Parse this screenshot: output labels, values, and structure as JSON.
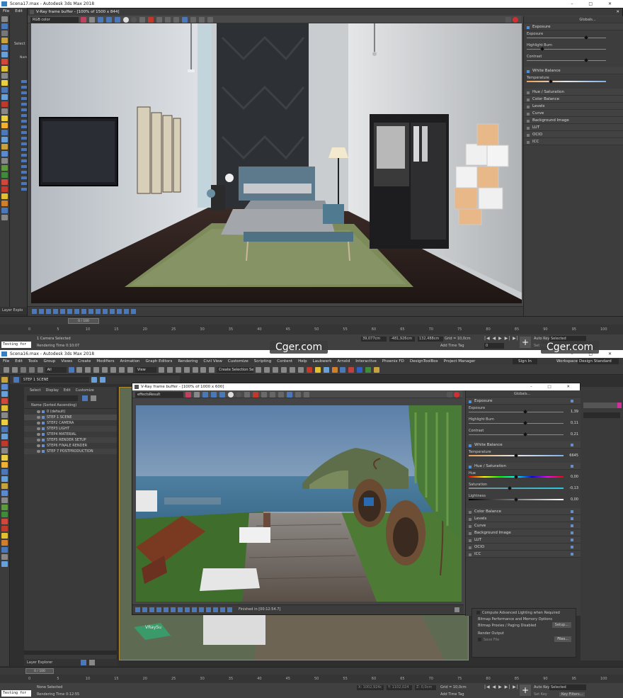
{
  "top": {
    "title": "Scena17.max - Autodesk 3ds Max 2018",
    "menu": [
      "File",
      "Edit"
    ],
    "toolbar_select": "Select",
    "toolbar_name": "Name",
    "vfb": {
      "title": "V-Ray frame buffer - [100% of 1500 x 844]",
      "channel": "RGB color",
      "globals": "Globals...",
      "layers": [
        {
          "label": "Exposure",
          "open": true
        },
        {
          "label": "White Balance",
          "open": true
        },
        {
          "label": "Hue / Saturation",
          "open": false
        },
        {
          "label": "Color Balance",
          "open": false
        },
        {
          "label": "Levels",
          "open": false
        },
        {
          "label": "Curve",
          "open": false
        },
        {
          "label": "Background Image",
          "open": false
        },
        {
          "label": "LUT",
          "open": false
        },
        {
          "label": "OCIO",
          "open": false
        },
        {
          "label": "ICC",
          "open": false
        }
      ],
      "exposure_fields": [
        {
          "label": "Exposure",
          "pos": 0.75
        },
        {
          "label": "Highlight Burn",
          "pos": 0.2
        },
        {
          "label": "Contrast",
          "pos": 0.75
        }
      ],
      "temperature_label": "Temperature",
      "temperature_pos": 0.3
    },
    "layer_explorer": "Layer Explo",
    "timeline": {
      "frame": "0 / 100",
      "ticks": [
        "0",
        "5",
        "10",
        "15",
        "20",
        "25",
        "30",
        "35",
        "40",
        "45",
        "50",
        "55",
        "60",
        "65",
        "70",
        "75",
        "80",
        "85",
        "90",
        "95",
        "100"
      ]
    },
    "status": {
      "selected": "1 Camera Selected",
      "rendering_time": "Rendering Time  0:10:07",
      "testing": "Testing for",
      "x": "39,077cm",
      "y": "-481,926cm",
      "z": "132,488cm",
      "grid": "Grid = 10,0cm",
      "add_time_tag": "Add Time Tag",
      "auto_key": "Auto Key",
      "selected_dd": "Selected",
      "set_key": "Set Key",
      "frame": "0"
    }
  },
  "bottom": {
    "title": "Scena16.max - Autodesk 3ds Max 2018",
    "menu": [
      "File",
      "Edit",
      "Tools",
      "Group",
      "Views",
      "Create",
      "Modifiers",
      "Animation",
      "Graph Editors",
      "Rendering",
      "Civil View",
      "Customize",
      "Scripting",
      "Content",
      "Help",
      "Laubwerk",
      "Arnold",
      "Interactive",
      "Phoenix FD",
      "DesignToolBox",
      "Project Manager"
    ],
    "sign_in": "Sign In",
    "workspaces_label": "Workspaces:",
    "workspace": "Design Standard",
    "filter_all": "All",
    "view_dd": "View",
    "create_selection": "Create Selection Se",
    "layer_dd": "STEP 1 SCENE",
    "explorer_tabs": [
      "Select",
      "Display",
      "Edit",
      "Customize"
    ],
    "sort_header": "Name (Sorted Ascending)",
    "scene_items": [
      "0 (default)",
      "STEP 1 SCENE",
      "STEP2 CAMERA",
      "STEP3 LIGHT",
      "STEP4 MATERIAL",
      "STEP5 RENDER SETUP",
      "STEP6 FINALE RENDER",
      "STEP 7 POSTPRODUCTION"
    ],
    "layer_explorer": "Layer Explorer",
    "timeline": {
      "frame": "0 / 100",
      "ticks": [
        "0",
        "5",
        "10",
        "15",
        "20",
        "25",
        "30",
        "35",
        "40",
        "45",
        "50",
        "55",
        "60",
        "65",
        "70",
        "75",
        "80",
        "85",
        "90",
        "95",
        "100"
      ]
    },
    "vfb": {
      "title": "V-Ray frame buffer - [100% of 1000 x 600]",
      "channel": "effectsResult",
      "globals": "Globals...",
      "status": "Finished in [00:12:54.7]",
      "exposure": {
        "label": "Exposure",
        "fields": [
          {
            "label": "Exposure",
            "value": "1,39",
            "pos": 0.6
          },
          {
            "label": "Highlight Burn",
            "value": "0,11",
            "pos": 0.6
          },
          {
            "label": "Contrast",
            "value": "0,21",
            "pos": 0.6
          }
        ]
      },
      "white_balance": {
        "label": "White Balance",
        "temp_label": "Temperature",
        "temp_value": "6645",
        "pos": 0.5
      },
      "hue_sat": {
        "label": "Hue / Saturation",
        "fields": [
          {
            "label": "Hue",
            "value": "0,00",
            "pos": 0.5
          },
          {
            "label": "Saturation",
            "value": "-0,13",
            "pos": 0.43
          },
          {
            "label": "Lightness",
            "value": "0,00",
            "pos": 0.5
          }
        ]
      },
      "closed": [
        "Color Balance",
        "Levels",
        "Curve",
        "Background Image",
        "LUT",
        "OCIO",
        "ICC"
      ]
    },
    "render_setup": {
      "compute": "Compute Advanced Lighting when Required",
      "bitmap_perf": "Bitmap Performance and Memory Options",
      "bitmap_proxies": "Bitmap Proxies / Paging Disabled",
      "setup_btn": "Setup...",
      "render_output": "Render Output",
      "save_file": "Save File",
      "files_btn": "Files..."
    },
    "status": {
      "selected": "None Selected",
      "rendering_time": "Rendering Time  0:12:55",
      "testing": "Testing for",
      "x": "X: 1002,924c",
      "y": "Y: 1102,024",
      "z": "Z: 0,0cm",
      "grid": "Grid = 10,0cm",
      "add_time_tag": "Add Time Tag",
      "auto_key": "Auto Key",
      "selected_dd": "Selected",
      "set_key": "Set Key",
      "key_filters": "Key Filters..."
    }
  },
  "watermarks": [
    "Cger.com",
    "Cger.com"
  ]
}
